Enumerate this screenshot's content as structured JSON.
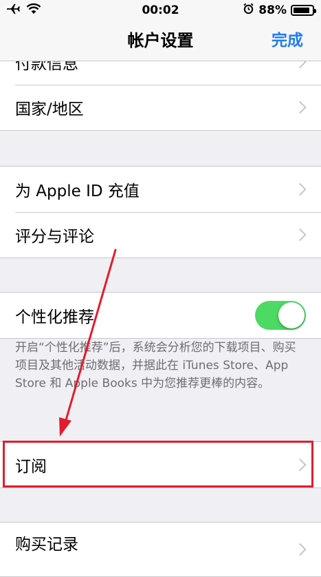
{
  "status_bar": {
    "time": "00:02",
    "battery": "88%",
    "battery_level": 0.88
  },
  "nav": {
    "title": "帐户设置",
    "done": "完成"
  },
  "groups": {
    "g1": [
      "付款信息",
      "国家/地区"
    ],
    "g2": [
      "为 Apple ID 充值",
      "评分与评论"
    ],
    "g3": {
      "label": "个性化推荐",
      "toggle_on": true
    },
    "g4": [
      "订阅"
    ],
    "g5": [
      "购买记录"
    ]
  },
  "note": "开启“个性化推荐”后，系统会分析您的下载项目、购买项目及其他活动数据，并据此在 iTunes Store、App Store 和 Apple Books 中为您推荐更棒的内容。",
  "colors": {
    "accent": "#1f7cf5",
    "toggle": "#4cd964",
    "highlight": "#e21c2d"
  }
}
